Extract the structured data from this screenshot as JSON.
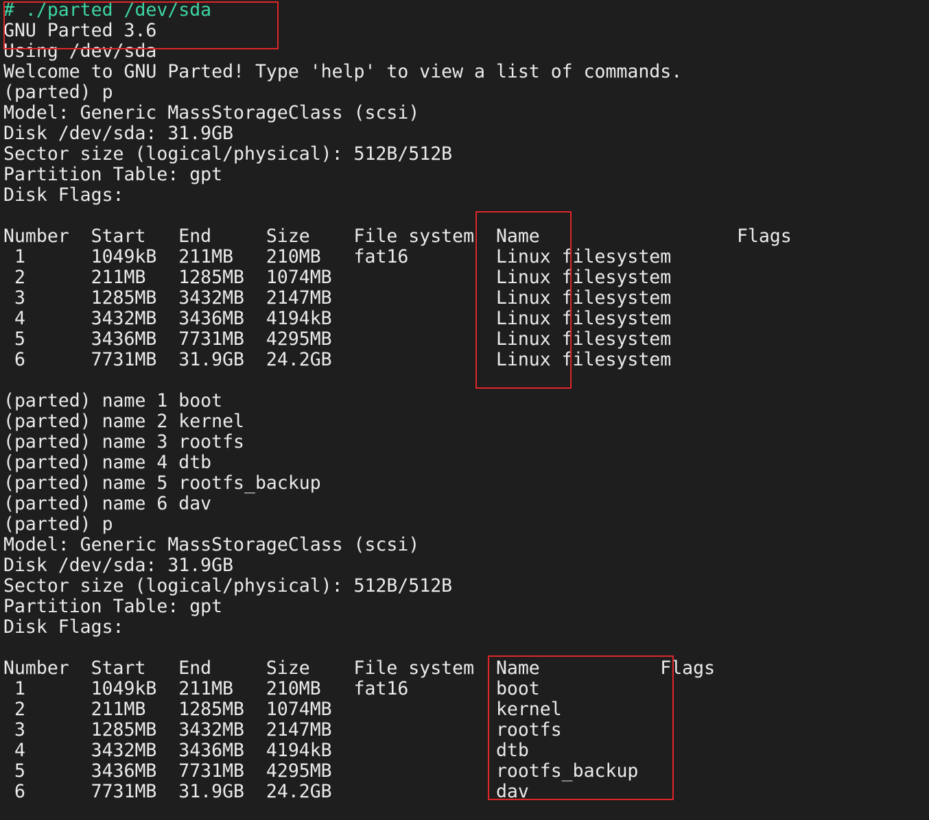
{
  "terminal": {
    "lines": [
      "# ./parted /dev/sda",
      "GNU Parted 3.6",
      "Using /dev/sda",
      "Welcome to GNU Parted! Type 'help' to view a list of commands.",
      "(parted) p",
      "Model: Generic MassStorageClass (scsi)",
      "Disk /dev/sda: 31.9GB",
      "Sector size (logical/physical): 512B/512B",
      "Partition Table: gpt",
      "Disk Flags:",
      "",
      "Number  Start   End     Size    File system  Name                  Flags",
      " 1      1049kB  211MB   210MB   fat16        Linux filesystem",
      " 2      211MB   1285MB  1074MB               Linux filesystem",
      " 3      1285MB  3432MB  2147MB               Linux filesystem",
      " 4      3432MB  3436MB  4194kB               Linux filesystem",
      " 5      3436MB  7731MB  4295MB               Linux filesystem",
      " 6      7731MB  31.9GB  24.2GB               Linux filesystem",
      "",
      "(parted) name 1 boot",
      "(parted) name 2 kernel",
      "(parted) name 3 rootfs",
      "(parted) name 4 dtb",
      "(parted) name 5 rootfs_backup",
      "(parted) name 6 dav",
      "(parted) p",
      "Model: Generic MassStorageClass (scsi)",
      "Disk /dev/sda: 31.9GB",
      "Sector size (logical/physical): 512B/512B",
      "Partition Table: gpt",
      "Disk Flags:",
      "",
      "Number  Start   End     Size    File system  Name           Flags",
      " 1      1049kB  211MB   210MB   fat16        boot",
      " 2      211MB   1285MB  1074MB               kernel",
      " 3      1285MB  3432MB  2147MB               rootfs",
      " 4      3432MB  3436MB  4194kB               dtb",
      " 5      3436MB  7731MB  4295MB               rootfs_backup",
      " 6      7731MB  31.9GB  24.2GB               dav"
    ]
  },
  "colors": {
    "background": "#1e1e1e",
    "text": "#ebebeb",
    "prompt": "#3dd6a0",
    "annotation": "#e0262a"
  }
}
